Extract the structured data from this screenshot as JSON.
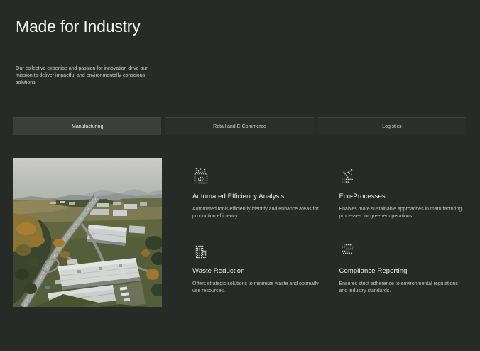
{
  "page": {
    "title": "Made for Industry",
    "subtitle": "Our collective expertise and passion for innovation drive our mission to deliver impactful and environmentally-conscious solutions.",
    "background_color": "#272b27",
    "accent_text_color": "#f3f4f0"
  },
  "tabs": [
    {
      "label": "Manufacturing",
      "active": true
    },
    {
      "label": "Retail and E-Commerce",
      "active": false
    },
    {
      "label": "Logistics",
      "active": false
    }
  ],
  "photo": {
    "description": "Aerial photograph of an industrial park: white-roofed warehouses beside a curving highway, surrounded by green fields, autumn trees and distant hills under a gray sky"
  },
  "features": [
    {
      "icon": "bar-chart-dotted-icon",
      "title": "Automated Efficiency Analysis",
      "description": "Automated tools efficiently identify and enhance areas for production efficiency."
    },
    {
      "icon": "process-flow-dotted-icon",
      "title": "Eco-Processes",
      "description": "Enables more sustainable approaches in manufacturing processes for greener operations."
    },
    {
      "icon": "factory-building-dotted-icon",
      "title": "Waste Reduction",
      "description": "Offers strategic solutions to minimize waste and optimally use resources."
    },
    {
      "icon": "report-lines-dotted-icon",
      "title": "Compliance Reporting",
      "description": "Ensures strict adherence to environmental regulations and industry standards."
    }
  ]
}
